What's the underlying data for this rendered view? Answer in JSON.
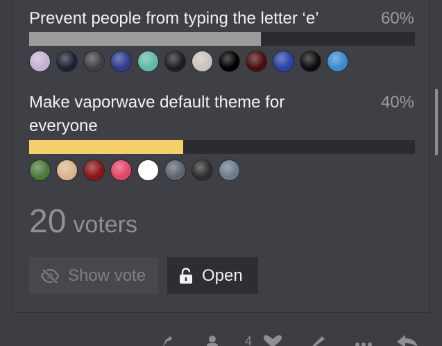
{
  "poll": {
    "options": [
      {
        "label": "Prevent people from typing the letter ‘e’",
        "percent_label": "60%",
        "percent": 60,
        "bar_color": "#9c9c9c",
        "avatars": [
          "#c4b1d4",
          "#1b2134",
          "#3e4046",
          "#2f3b8f",
          "#5fb9a7",
          "#1e1e22",
          "#c9c2bd",
          "#000000",
          "#4a0d0d",
          "#2743a8",
          "#0c0c0c",
          "#3a8bd0"
        ]
      },
      {
        "label": "Make vaporwave default theme for everyone",
        "percent_label": "40%",
        "percent": 40,
        "bar_color": "#f4cf6a",
        "avatars": [
          "#4a7a3a",
          "#d9b48a",
          "#8a1515",
          "#e2466b",
          "#ffffff",
          "#5c6470",
          "#2e2e2e",
          "#6b7a8f"
        ]
      }
    ],
    "voters_count": "20",
    "voters_label": "voters",
    "buttons": {
      "show_vote": "Show vote",
      "open": "Open"
    }
  },
  "colors": {
    "background": "#3c3e44",
    "bar_track": "#2a2c2f",
    "text_primary": "#f2f2f2",
    "text_muted": "#9a9ca1"
  },
  "icons": {
    "show_vote": "eye-slash-icon",
    "open": "unlock-icon",
    "bottom_bar": [
      "wrench-icon",
      "user-icon",
      "heart-icon",
      "pencil-icon",
      "more-icon",
      "reply-icon"
    ]
  },
  "bottom_bar": {
    "like_count": "4"
  }
}
